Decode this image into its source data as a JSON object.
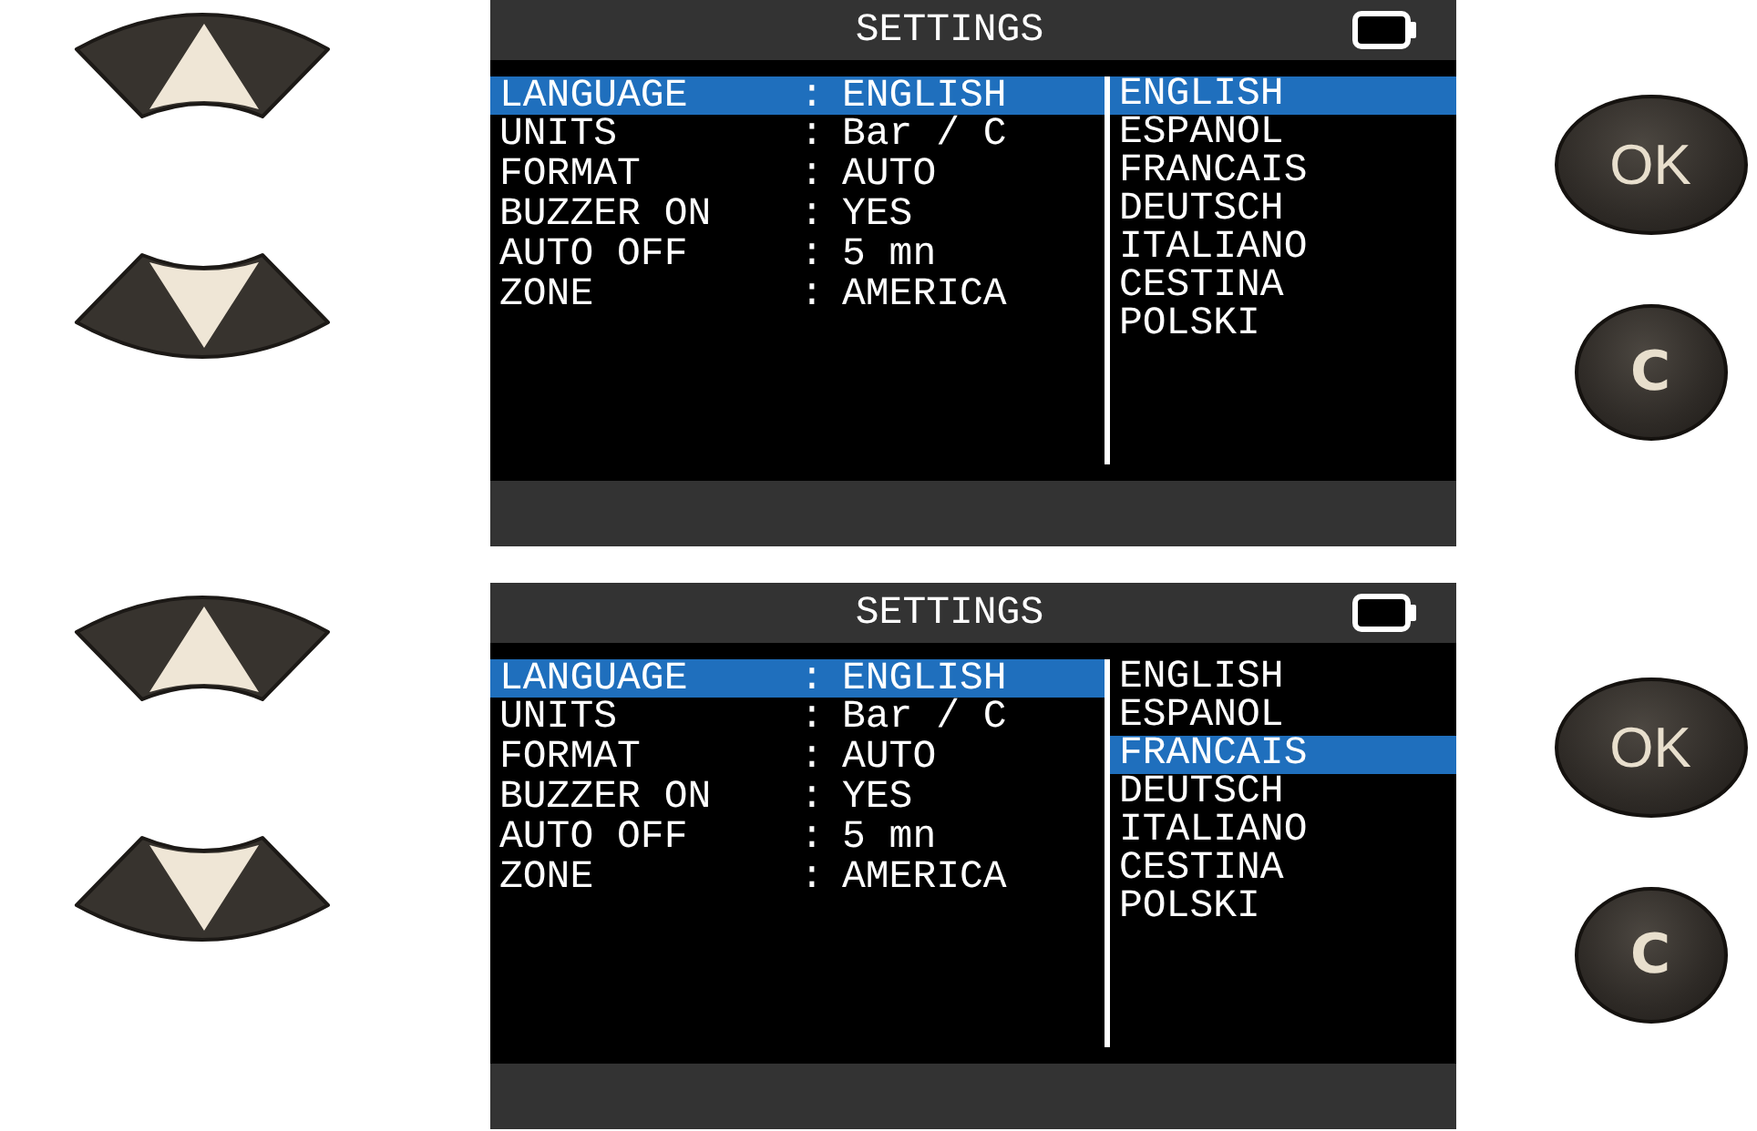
{
  "panels": [
    {
      "screen": {
        "title": "SETTINGS",
        "settings": [
          {
            "label": "LANGUAGE",
            "separator": ":",
            "value": "ENGLISH",
            "selected": true
          },
          {
            "label": "UNITS",
            "separator": ":",
            "value": "Bar / C",
            "selected": false
          },
          {
            "label": "FORMAT",
            "separator": ":",
            "value": "AUTO",
            "selected": false
          },
          {
            "label": "BUZZER ON",
            "separator": ":",
            "value": "YES",
            "selected": false
          },
          {
            "label": "AUTO OFF",
            "separator": ":",
            "value": "5 mn",
            "selected": false
          },
          {
            "label": "ZONE",
            "separator": ":",
            "value": "AMERICA",
            "selected": false
          }
        ],
        "languages": [
          {
            "label": "ENGLISH",
            "selected": true
          },
          {
            "label": "ESPANOL",
            "selected": false
          },
          {
            "label": "FRANCAIS",
            "selected": false
          },
          {
            "label": "DEUTSCH",
            "selected": false
          },
          {
            "label": "ITALIANO",
            "selected": false
          },
          {
            "label": "CESTINA",
            "selected": false
          },
          {
            "label": "POLSKI",
            "selected": false
          }
        ]
      },
      "keys": [
        {
          "kind": "ok",
          "label": "OK"
        },
        {
          "kind": "clear",
          "label": "C"
        }
      ]
    },
    {
      "screen": {
        "title": "SETTINGS",
        "settings": [
          {
            "label": "LANGUAGE",
            "separator": ":",
            "value": "ENGLISH",
            "selected": true
          },
          {
            "label": "UNITS",
            "separator": ":",
            "value": "Bar / C",
            "selected": false
          },
          {
            "label": "FORMAT",
            "separator": ":",
            "value": "AUTO",
            "selected": false
          },
          {
            "label": "BUZZER ON",
            "separator": ":",
            "value": "YES",
            "selected": false
          },
          {
            "label": "AUTO OFF",
            "separator": ":",
            "value": "5 mn",
            "selected": false
          },
          {
            "label": "ZONE",
            "separator": ":",
            "value": "AMERICA",
            "selected": false
          }
        ],
        "languages": [
          {
            "label": "ENGLISH",
            "selected": false
          },
          {
            "label": "ESPANOL",
            "selected": false
          },
          {
            "label": "FRANCAIS",
            "selected": true
          },
          {
            "label": "DEUTSCH",
            "selected": false
          },
          {
            "label": "ITALIANO",
            "selected": false
          },
          {
            "label": "CESTINA",
            "selected": false
          },
          {
            "label": "POLSKI",
            "selected": false
          }
        ]
      },
      "keys": [
        {
          "kind": "ok",
          "label": "OK"
        },
        {
          "kind": "clear",
          "label": "C"
        }
      ]
    }
  ]
}
